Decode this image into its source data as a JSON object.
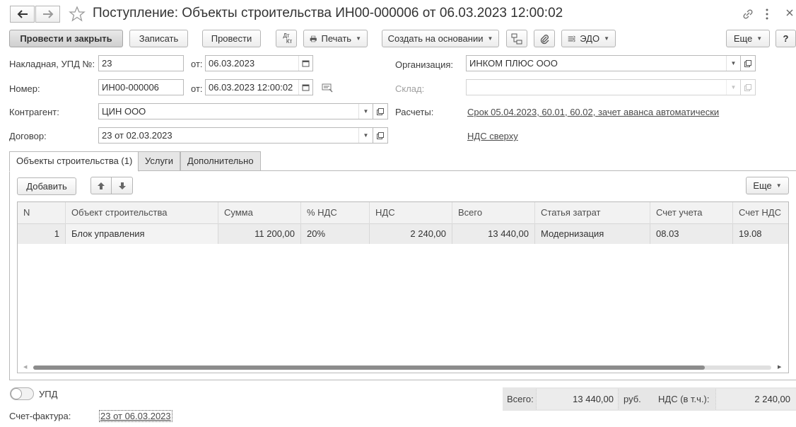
{
  "window": {
    "title": "Поступление: Объекты строительства ИН00-000006 от 06.03.2023 12:00:02",
    "back_icon": "arrow-left-icon",
    "forward_icon": "arrow-right-icon",
    "favorite_icon": "star-icon",
    "link_icon": "link-icon",
    "menu_icon": "more-vertical-icon",
    "close_icon": "close-icon"
  },
  "toolbar": {
    "post_and_close": "Провести и закрыть",
    "save": "Записать",
    "post": "Провести",
    "dt_kt_top": "Дт",
    "dt_kt_bottom": "Кт",
    "print": "Печать",
    "create_based_on": "Создать на основании",
    "edo": "ЭДО",
    "more": "Еще",
    "help": "?"
  },
  "header": {
    "invoice_label": "Накладная, УПД №:",
    "invoice_value": "23",
    "from_label": "от:",
    "invoice_date": "06.03.2023",
    "number_label": "Номер:",
    "number_value": "ИН00-000006",
    "from_label2": "от:",
    "number_date": "06.03.2023 12:00:02",
    "counterparty_label": "Контрагент:",
    "counterparty_value": "ЦИН ООО",
    "contract_label": "Договор:",
    "contract_value": "23 от 02.03.2023",
    "organization_label": "Организация:",
    "organization_value": "ИНКОМ ПЛЮС ООО",
    "warehouse_label": "Склад:",
    "warehouse_value": "",
    "settlements_label": "Расчеты:",
    "settlements_link": "Срок 05.04.2023, 60.01, 60.02, зачет аванса автоматически",
    "vat_link": "НДС сверху"
  },
  "tabs": [
    {
      "label": "Объекты строительства (1)"
    },
    {
      "label": "Услуги"
    },
    {
      "label": "Дополнительно"
    }
  ],
  "table_toolbar": {
    "add": "Добавить",
    "more": "Еще"
  },
  "table": {
    "columns": [
      "N",
      "Объект строительства",
      "Сумма",
      "% НДС",
      "НДС",
      "Всего",
      "Статья затрат",
      "Счет учета",
      "Счет НДС"
    ],
    "rows": [
      [
        "1",
        "Блок управления",
        "11 200,00",
        "20%",
        "2 240,00",
        "13 440,00",
        "Модернизация",
        "08.03",
        "19.08"
      ]
    ]
  },
  "footer": {
    "upd_label": "УПД",
    "upd_enabled": false,
    "invoice_label": "Счет-фактура:",
    "invoice_link": "23 от 06.03.2023",
    "total_label": "Всего:",
    "total_value": "13 440,00",
    "currency": "руб.",
    "vat_label": "НДС (в т.ч.):",
    "vat_value": "2 240,00"
  }
}
